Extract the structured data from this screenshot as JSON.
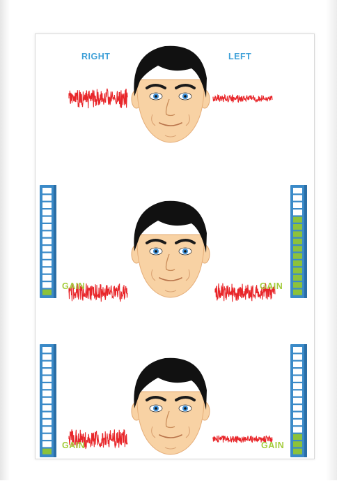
{
  "colors": {
    "ear_label": "#3ea0d8",
    "gain_label": "#a4cc3c",
    "waveform": "#e8262a",
    "meter_frame": "#3a8ac8",
    "meter_cell_empty": "#ffffff",
    "meter_cell_on": "#8cc23a",
    "skin": "#f8d2a4",
    "hair": "#111111",
    "eye_iris": "#3b8fd8"
  },
  "icons": [
    "face-icon",
    "waveform-icon",
    "gain-meter-icon"
  ],
  "panels": [
    {
      "id": "top",
      "right_label": "RIGHT",
      "left_label": "LEFT",
      "right_wave_level": 0.9,
      "left_wave_level": 0.35
    },
    {
      "id": "middle",
      "right_wave_level": 0.85,
      "left_wave_level": 0.85,
      "right_gain": {
        "label": "GAIN",
        "level_segments": 1,
        "total_segments": 15
      },
      "left_gain": {
        "label": "GAIN",
        "level_segments": 11,
        "total_segments": 15
      }
    },
    {
      "id": "bottom",
      "right_wave_level": 0.9,
      "left_wave_level": 0.35,
      "right_gain": {
        "label": "GAIN",
        "level_segments": 1,
        "total_segments": 15
      },
      "left_gain": {
        "label": "GAIN",
        "level_segments": 3,
        "total_segments": 15
      }
    }
  ]
}
